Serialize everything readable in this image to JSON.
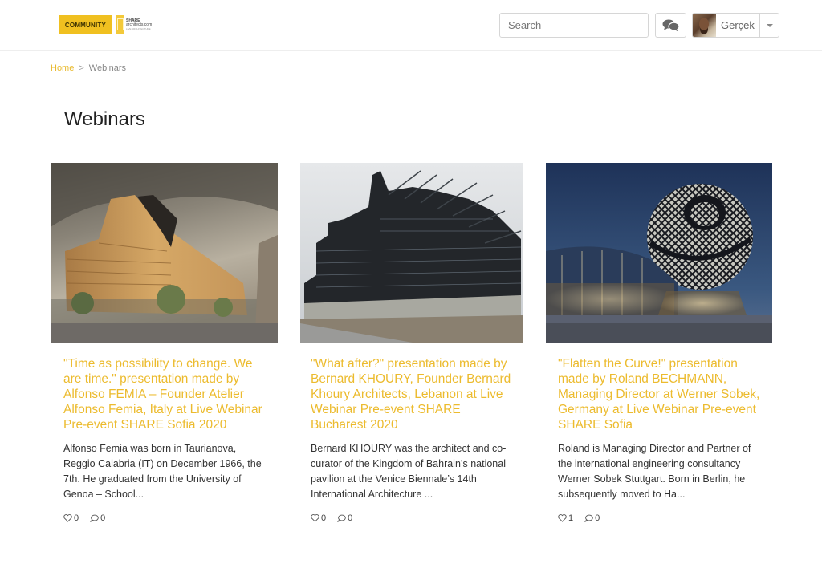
{
  "header": {
    "logo": {
      "community": "COMMUNITY",
      "share_line1": "SHARE",
      "share_line2": "architects.com",
      "share_line3": "LIVE ARCHITECTURE"
    },
    "search": {
      "placeholder": "Search",
      "value": ""
    },
    "icons": {
      "search": "search-icon",
      "chat": "chat-bubbles-icon",
      "caret": "caret-down-icon"
    },
    "user": {
      "name": "Gerçek"
    }
  },
  "breadcrumb": {
    "home": "Home",
    "separator": ">",
    "current": "Webinars"
  },
  "page": {
    "title": "Webinars"
  },
  "colors": {
    "accent": "#ecbb2e",
    "logo_yellow": "#f0c020",
    "text": "#333333"
  },
  "cards": [
    {
      "title": "\"Time as possibility to change. We are time.\" presentation made by Alfonso FEMIA – Founder Atelier Alfonso Femia, Italy at Live Webinar Pre-event SHARE Sofia 2020",
      "excerpt": "Alfonso Femia was born in Taurianova, Reggio Calabria (IT) on December 1966, the 7th. He graduated from the University of Genoa – School...",
      "likes": "0",
      "comments": "0",
      "image": "wooden-facade-building-render"
    },
    {
      "title": "\"What after?\" presentation made by Bernard KHOURY, Founder Bernard Khoury Architects, Lebanon at Live Webinar Pre-event SHARE Bucharest 2020",
      "excerpt": "Bernard KHOURY was the architect and co-curator of the Kingdom of Bahrain’s national pavilion at the Venice Biennale’s 14th International Architecture ...",
      "likes": "0",
      "comments": "0",
      "image": "dark-steel-residential-building"
    },
    {
      "title": "\"Flatten the Curve!\" presentation made by Roland BECHMANN, Managing Director at Werner Sobek, Germany at Live Webinar Pre-event SHARE Sofia",
      "excerpt": "Roland is Managing Director and Partner of the international engineering consultancy Werner Sobek Stuttgart. Born in Berlin, he subsequently moved to Ha...",
      "likes": "1",
      "comments": "0",
      "image": "spherical-pavilion-at-dusk"
    }
  ]
}
